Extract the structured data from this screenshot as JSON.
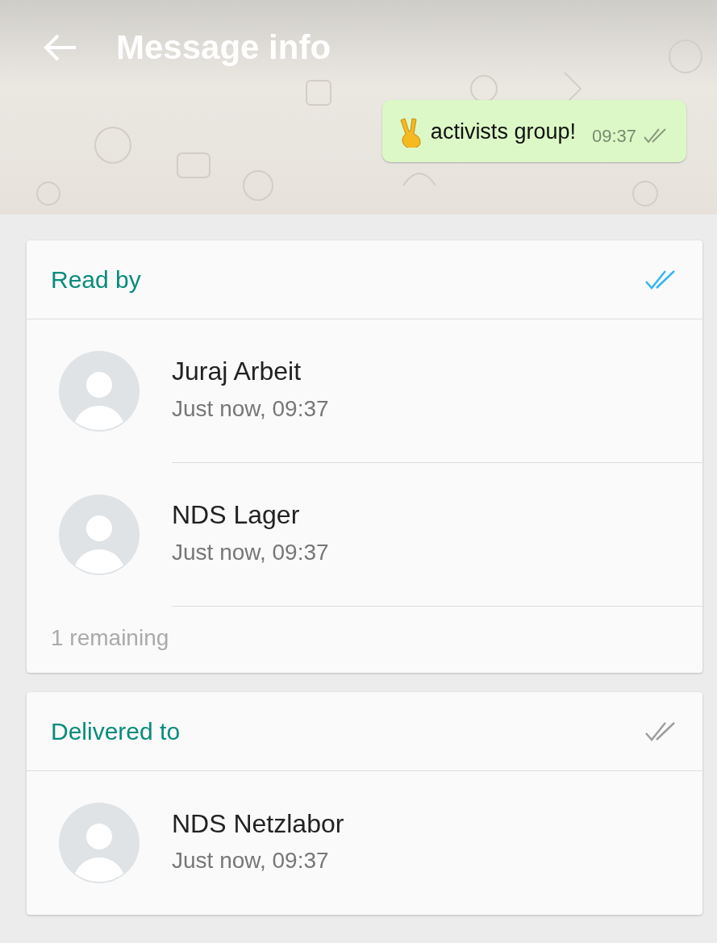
{
  "header": {
    "title": "Message info"
  },
  "message": {
    "text": "activists group!",
    "time": "09:37"
  },
  "sections": [
    {
      "title": "Read by",
      "color": "#34b7f1",
      "contacts": [
        {
          "name": "Juraj Arbeit",
          "time": "Just now, 09:37"
        },
        {
          "name": "NDS Lager",
          "time": "Just now, 09:37"
        }
      ],
      "remaining": "1 remaining"
    },
    {
      "title": "Delivered to",
      "color": "#9e9e9e",
      "contacts": [
        {
          "name": "NDS Netzlabor",
          "time": "Just now, 09:37"
        }
      ]
    }
  ]
}
